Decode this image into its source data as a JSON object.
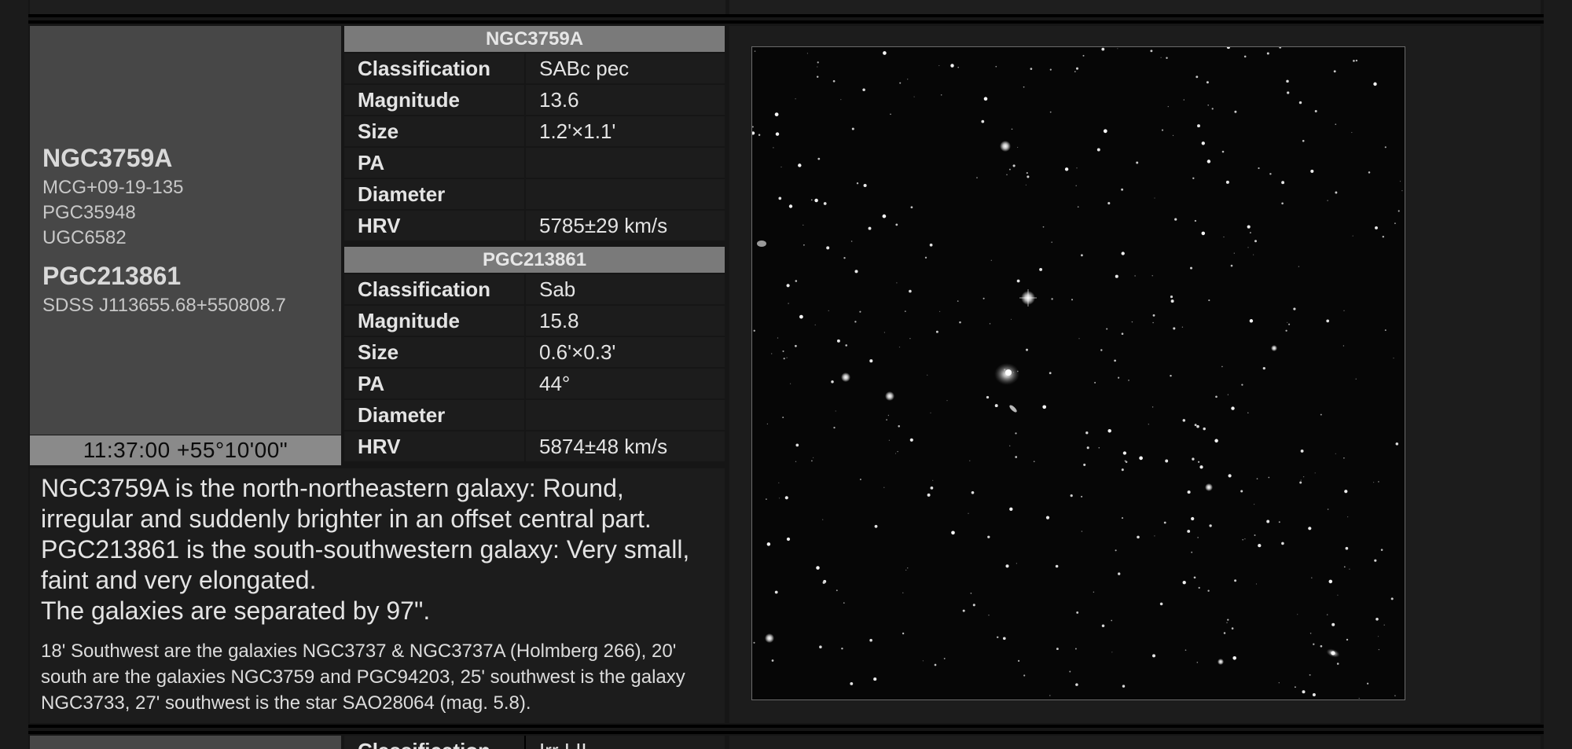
{
  "object": {
    "primary_name": "NGC3759A",
    "aliases": [
      "MCG+09-19-135",
      "PGC35948",
      "UGC6582"
    ],
    "secondary_name": "PGC213861",
    "secondary_aliases": [
      "SDSS J113655.68+550808.7"
    ],
    "coordinates": "11:37:00 +55°10'00\""
  },
  "tables": [
    {
      "title": "NGC3759A",
      "rows": [
        {
          "label": "Classification",
          "value": "SABc pec"
        },
        {
          "label": "Magnitude",
          "value": "13.6"
        },
        {
          "label": "Size",
          "value": "1.2'×1.1'"
        },
        {
          "label": "PA",
          "value": ""
        },
        {
          "label": "Diameter",
          "value": ""
        },
        {
          "label": "HRV",
          "value": "5785±29 km/s"
        }
      ]
    },
    {
      "title": "PGC213861",
      "rows": [
        {
          "label": "Classification",
          "value": "Sab"
        },
        {
          "label": "Magnitude",
          "value": "15.8"
        },
        {
          "label": "Size",
          "value": "0.6'×0.3'"
        },
        {
          "label": "PA",
          "value": "44°"
        },
        {
          "label": "Diameter",
          "value": ""
        },
        {
          "label": "HRV",
          "value": "5874±48 km/s"
        }
      ]
    }
  ],
  "description": {
    "lines": [
      "NGC3759A is the north-northeastern galaxy: Round, irregular and suddenly brighter in an offset central part.",
      "PGC213861 is the south-southwestern galaxy: Very small, faint and very elongated.",
      "The galaxies are separated by 97\"."
    ],
    "surroundings": "18' Southwest are the galaxies NGC3737 & NGC3737A (Holmberg 266), 20' south are the galaxies NGC3759 and PGC94203, 25' southwest is the galaxy NGC3733, 27' southwest is the star SAO28064 (mag. 5.8)."
  },
  "next_row": {
    "label": "Classification",
    "value": "Irr I II"
  },
  "image": {
    "kind": "starfield-image"
  }
}
